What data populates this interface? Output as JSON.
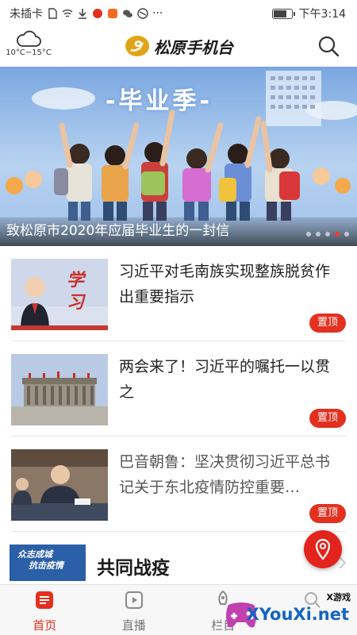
{
  "status_bar": {
    "carrier": "未插卡",
    "time": "下午3:14",
    "more": "···",
    "battery_level": 0.7
  },
  "header": {
    "weather_temp": "10°C~15°C",
    "brand": "松原手机台",
    "weather_icon": "cloud-icon",
    "search_icon": "search-icon"
  },
  "banner": {
    "title": "-毕业季-",
    "caption": "致松原市2020年应届毕业生的一封信",
    "dots": 5,
    "active_dot": 3
  },
  "news": [
    {
      "title": "习近平对毛南族实现整族脱贫作出重要指示",
      "badge": "置顶",
      "thumb_text": "学习"
    },
    {
      "title": "两会来了！习近平的嘱托一以贯之",
      "badge": "置顶"
    },
    {
      "title": "巴音朝鲁：坚决贯彻习近平总书记关于东北疫情防控重要…",
      "badge": "置顶"
    }
  ],
  "section": {
    "thumb_line1": "众志成城",
    "thumb_line2": "抗击疫情",
    "title": "共同战疫"
  },
  "tabs": [
    {
      "label": "首页",
      "active": true,
      "icon": "home-icon"
    },
    {
      "label": "直播",
      "active": false,
      "icon": "live-icon"
    },
    {
      "label": "栏目",
      "active": false,
      "icon": "rocket-icon"
    },
    {
      "label": "",
      "active": false,
      "icon": "search-icon"
    }
  ],
  "watermark": {
    "small": "X游戏",
    "big": "XYouXi.net"
  },
  "colors": {
    "accent": "#e3301f",
    "banner_sky": "#7aa7e1",
    "section_blue": "#2b5fa8"
  }
}
